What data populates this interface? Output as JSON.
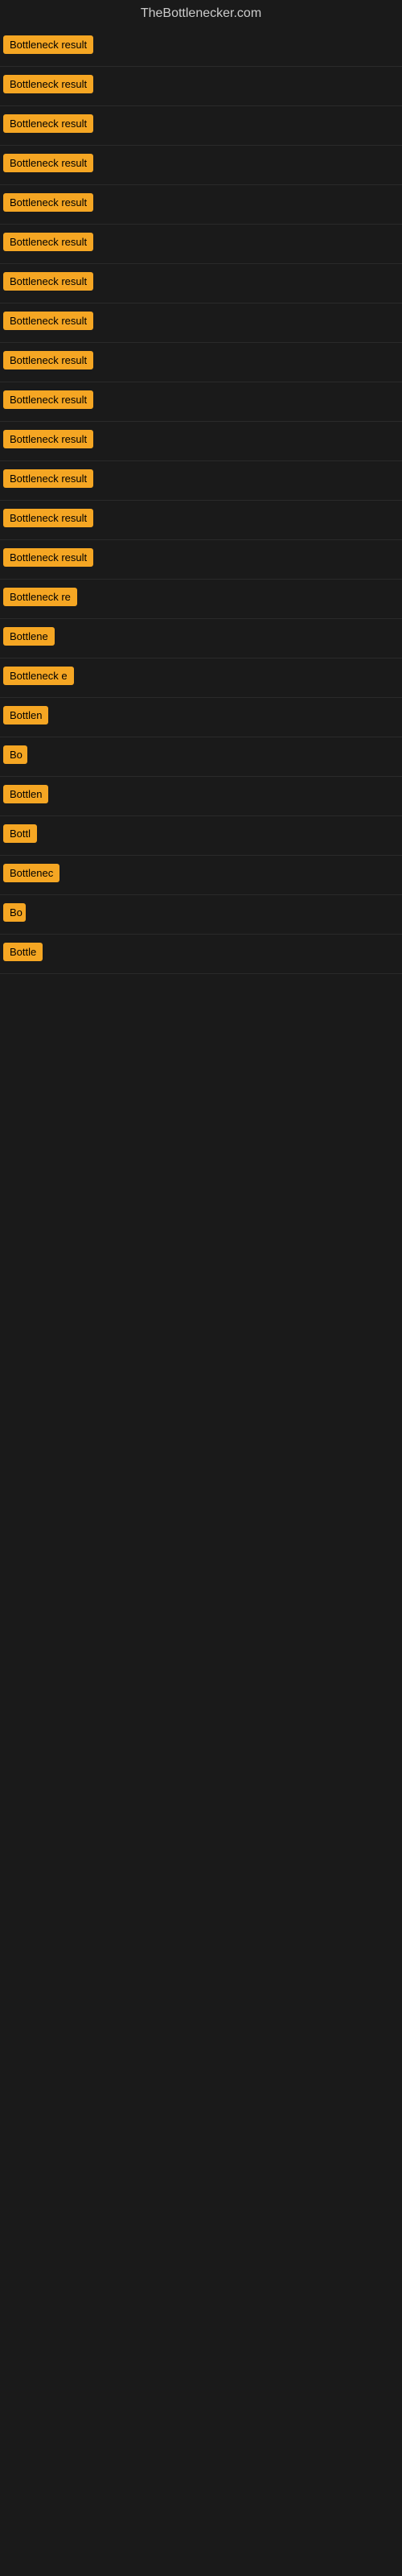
{
  "site": {
    "title": "TheBottlenecker.com"
  },
  "rows": [
    {
      "id": 1,
      "label": "Bottleneck result",
      "width": 120
    },
    {
      "id": 2,
      "label": "Bottleneck result",
      "width": 120
    },
    {
      "id": 3,
      "label": "Bottleneck result",
      "width": 120
    },
    {
      "id": 4,
      "label": "Bottleneck result",
      "width": 120
    },
    {
      "id": 5,
      "label": "Bottleneck result",
      "width": 120
    },
    {
      "id": 6,
      "label": "Bottleneck result",
      "width": 120
    },
    {
      "id": 7,
      "label": "Bottleneck result",
      "width": 120
    },
    {
      "id": 8,
      "label": "Bottleneck result",
      "width": 120
    },
    {
      "id": 9,
      "label": "Bottleneck result",
      "width": 120
    },
    {
      "id": 10,
      "label": "Bottleneck result",
      "width": 120
    },
    {
      "id": 11,
      "label": "Bottleneck result",
      "width": 120
    },
    {
      "id": 12,
      "label": "Bottleneck result",
      "width": 120
    },
    {
      "id": 13,
      "label": "Bottleneck result",
      "width": 120
    },
    {
      "id": 14,
      "label": "Bottleneck result",
      "width": 120
    },
    {
      "id": 15,
      "label": "Bottleneck re",
      "width": 100
    },
    {
      "id": 16,
      "label": "Bottlene",
      "width": 80
    },
    {
      "id": 17,
      "label": "Bottleneck e",
      "width": 95
    },
    {
      "id": 18,
      "label": "Bottlen",
      "width": 75
    },
    {
      "id": 19,
      "label": "Bo",
      "width": 30
    },
    {
      "id": 20,
      "label": "Bottlen",
      "width": 75
    },
    {
      "id": 21,
      "label": "Bottl",
      "width": 55
    },
    {
      "id": 22,
      "label": "Bottlenec",
      "width": 85
    },
    {
      "id": 23,
      "label": "Bo",
      "width": 28
    },
    {
      "id": 24,
      "label": "Bottle",
      "width": 60
    }
  ]
}
